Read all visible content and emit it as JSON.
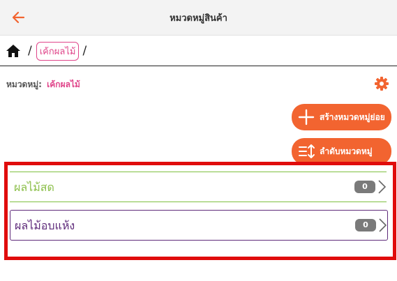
{
  "header": {
    "title": "หมวดหมู่สินค้า",
    "back_icon": "arrow-left-icon",
    "accent": "#f26430"
  },
  "breadcrumb": {
    "home_icon": "home-icon",
    "separator": "/",
    "current": "เค้กผลไม้",
    "trailing_separator": "/"
  },
  "category": {
    "label": "หมวดหมู่:",
    "name": "เค้กผลไม้",
    "settings_icon": "gear-icon"
  },
  "actions": {
    "create_label": "สร้างหมวดหมู่ย่อย",
    "create_icon": "plus-icon",
    "sort_label": "ลำดับหมวดหมู่",
    "sort_icon": "sort-icon",
    "color": "#f26430"
  },
  "subcategories": [
    {
      "name": "ผลไม้สด",
      "count": "0",
      "color": "#8cbf4a"
    },
    {
      "name": "ผลไม้อบแห้ง",
      "count": "0",
      "color": "#5e2a7a"
    }
  ],
  "highlight_color": "#e00c0c"
}
